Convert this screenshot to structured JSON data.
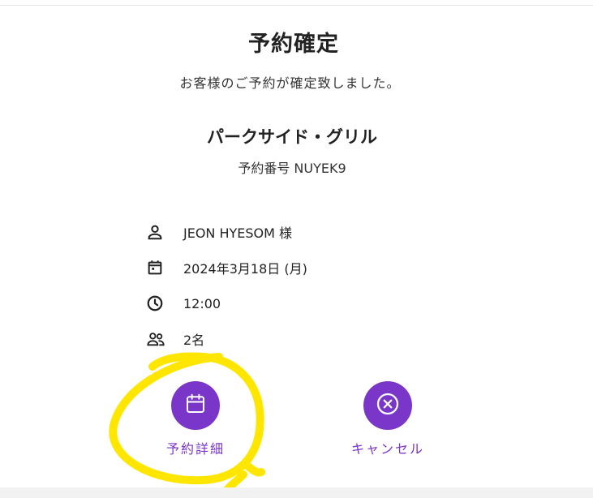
{
  "title": "予約確定",
  "subtitle": "お客様のご予約が確定致しました。",
  "restaurant_name": "パークサイド・グリル",
  "reservation_number": "予約番号 NUYEK9",
  "details": {
    "guest": "JEON HYESOM 様",
    "date": "2024年3月18日 (月)",
    "time": "12:00",
    "party_size": "2名"
  },
  "actions": {
    "details_label": "予約詳細",
    "cancel_label": "キャンセル"
  },
  "colors": {
    "accent": "#7a35c9",
    "highlight": "#ffe600"
  },
  "icons": {
    "guest": "person-icon",
    "date": "calendar-icon",
    "time": "clock-icon",
    "party_size": "people-icon",
    "details_button": "calendar-icon",
    "cancel_button": "x-circle-icon"
  }
}
